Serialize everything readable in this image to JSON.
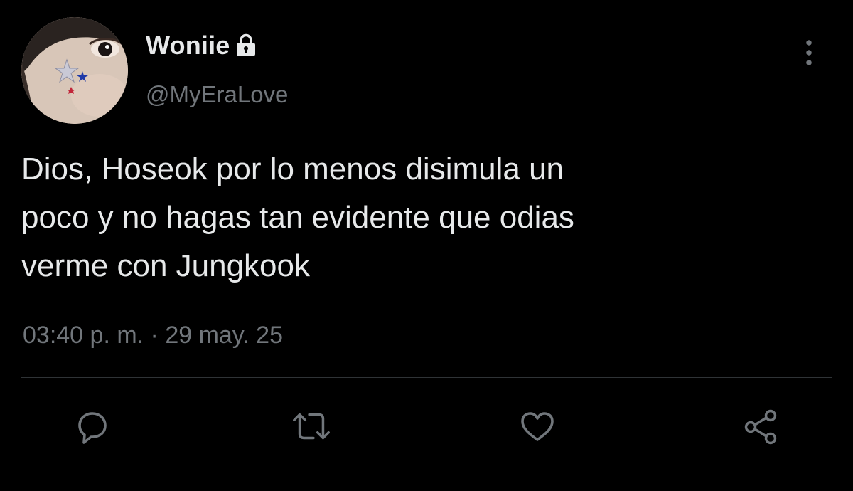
{
  "user": {
    "display_name": "Woniie",
    "handle": "@MyEraLove",
    "protected_icon": "lock-icon",
    "avatar": "avatar-photo"
  },
  "tweet": {
    "text": "Dios, Hoseok por lo menos disimula un\npoco y no hagas tan evidente que odias\nverme con Jungkook",
    "timestamp": "03:40 p. m. · 29 may. 25"
  },
  "actions": {
    "reply_icon": "reply-icon",
    "retweet_icon": "retweet-icon",
    "like_icon": "heart-icon",
    "share_icon": "share-icon",
    "more_icon": "more-vertical-icon"
  },
  "colors": {
    "background": "#000000",
    "text_primary": "#e7e9ea",
    "text_secondary": "#71767b",
    "divider": "#2f3336"
  }
}
